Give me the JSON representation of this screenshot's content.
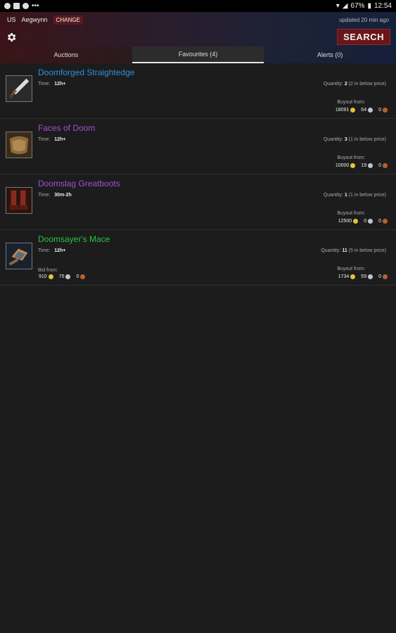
{
  "statusbar": {
    "dots": "•••",
    "battery": "67%",
    "time": "12:54"
  },
  "header": {
    "region": "US",
    "realm": "Aegwynn",
    "change_label": "CHANGE",
    "updated": "updated 20 min ago",
    "search_label": "SEARCH"
  },
  "tabs": [
    {
      "label": "Auctions"
    },
    {
      "label": "Favourites (4)"
    },
    {
      "label": "Alerts (0)"
    }
  ],
  "labels": {
    "time": "Time:",
    "quantity": "Quantity:",
    "buyout": "Buyout from:",
    "bid": "Bid from:"
  },
  "items": [
    {
      "name": "Doomforged Straightedge",
      "name_color": "#2f8fe0",
      "time": "12h+",
      "qty": "2",
      "qty_note": "(2 in below price)",
      "buyout": {
        "gold": "18091",
        "silver": "64",
        "copper": "0"
      }
    },
    {
      "name": "Faces of Doom",
      "name_color": "#a24fd8",
      "time": "12h+",
      "qty": "3",
      "qty_note": "(1 in below price)",
      "buyout": {
        "gold": "10000",
        "silver": "19",
        "copper": "0"
      }
    },
    {
      "name": "Doomslag Greatboots",
      "name_color": "#a24fd8",
      "time": "30m-2h",
      "qty": "1",
      "qty_note": "(1 in below price)",
      "buyout": {
        "gold": "12500",
        "silver": "0",
        "copper": "0"
      }
    },
    {
      "name": "Doomsayer's Mace",
      "name_color": "#2ec23a",
      "time": "12h+",
      "qty": "11",
      "qty_note": "(5 in below price)",
      "bid": {
        "gold": "910",
        "silver": "75",
        "copper": "0"
      },
      "buyout": {
        "gold": "1734",
        "silver": "59",
        "copper": "0"
      }
    }
  ]
}
